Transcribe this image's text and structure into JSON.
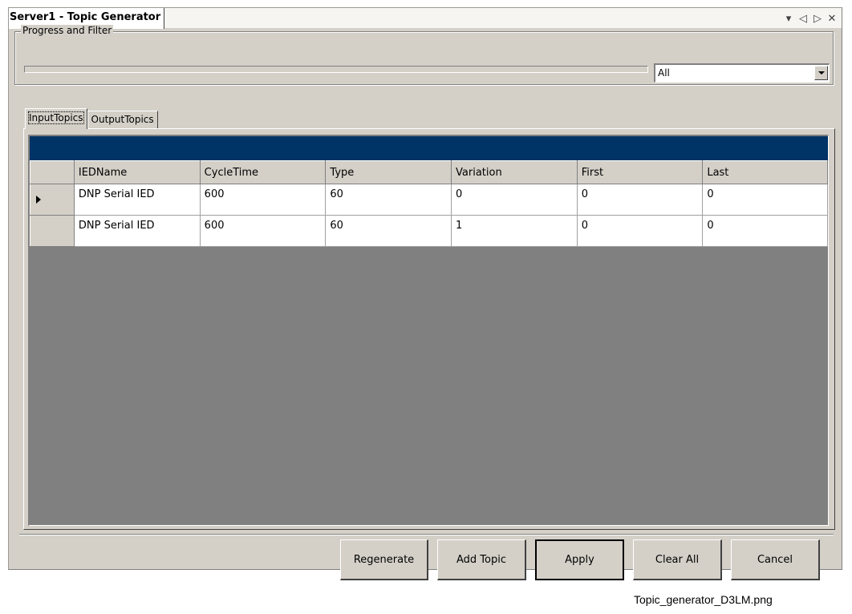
{
  "window": {
    "tab_title": "Server1 - Topic Generator",
    "controls": {
      "dropdown": "▾",
      "prev": "◁",
      "next": "▷",
      "close": "✕"
    }
  },
  "progress_filter": {
    "label": "Progress and Filter",
    "filter_value": "All"
  },
  "tabs": [
    {
      "label": "InputTopics",
      "active": true
    },
    {
      "label": "OutputTopics",
      "active": false
    }
  ],
  "grid": {
    "caption_color": "#003366",
    "columns": [
      "IEDName",
      "CycleTime",
      "Type",
      "Variation",
      "First",
      "Last"
    ],
    "rows": [
      {
        "current": true,
        "cells": [
          "DNP Serial IED",
          "600",
          "60",
          "0",
          "0",
          "0"
        ]
      },
      {
        "current": false,
        "cells": [
          "DNP Serial IED",
          "600",
          "60",
          "1",
          "0",
          "0"
        ]
      }
    ]
  },
  "buttons": {
    "regenerate": "Regenerate",
    "add_topic": "Add Topic",
    "apply": "Apply",
    "clear_all": "Clear All",
    "cancel": "Cancel"
  },
  "file_caption": "Topic_generator_D3LM.png"
}
